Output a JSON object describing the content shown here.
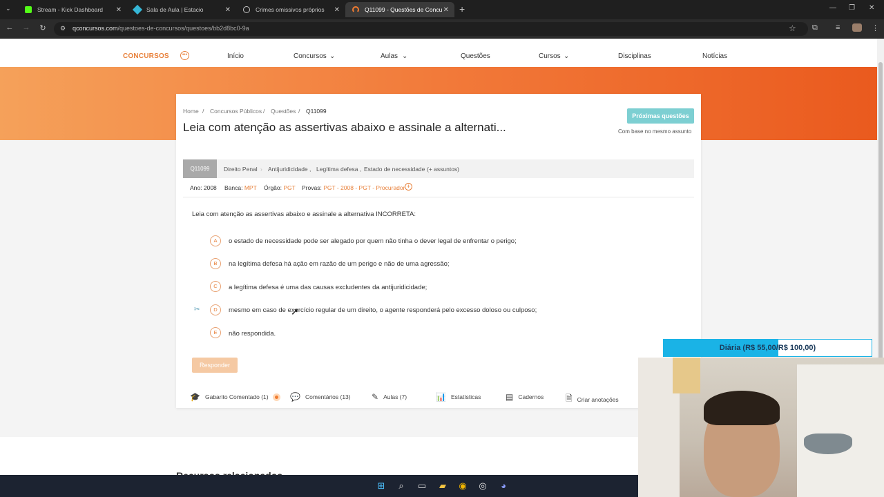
{
  "browser": {
    "tabs": [
      {
        "title": "Stream - Kick Dashboard",
        "active": false
      },
      {
        "title": "Sala de Aula | Estacio",
        "active": false
      },
      {
        "title": "Crimes omissivos próprios",
        "active": false
      },
      {
        "title": "Q11099 - Questões de Concurs",
        "active": true
      }
    ],
    "url_host": "qconcursos.com",
    "url_path": "/questoes-de-concursos/questoes/bb2d8bc0-9a"
  },
  "site": {
    "brand": "CONCURSOS",
    "nav": [
      "Início",
      "Concursos",
      "Aulas",
      "Questões",
      "Cursos",
      "Disciplinas",
      "Notícias"
    ],
    "breadcrumb": [
      "Home",
      "Concursos Públicos",
      "Questões",
      "Q11099"
    ],
    "title": "Leia com atenção as assertivas abaixo e assinale a alternati...",
    "next_button": "Próximas questões",
    "next_note": "Com base no mesmo assunto",
    "question": {
      "id": "Q11099",
      "subjects": [
        "Direito Penal",
        "Antijuridicidade ,",
        "Legítima defesa ,",
        "Estado de necessidade",
        "(+ assuntos)"
      ],
      "ano_label": "Ano:",
      "ano": "2008",
      "banca_label": "Banca:",
      "banca": "MPT",
      "orgao_label": "Órgão:",
      "orgao": "PGT",
      "provas_label": "Provas:",
      "provas": "PGT - 2008 - PGT - Procurador",
      "stem": "Leia com atenção as assertivas abaixo e assinale a alternativa INCORRETA:",
      "options": [
        {
          "letter": "A",
          "text": "o estado de necessidade pode ser alegado por quem não tinha o dever legal de enfrentar o perigo;"
        },
        {
          "letter": "B",
          "text": "na legítima defesa há ação em razão de um perigo e não de uma agressão;"
        },
        {
          "letter": "C",
          "text": "a legítima defesa é uma das causas excludentes da antijuridicidade;"
        },
        {
          "letter": "D",
          "text": "mesmo em caso de exercício regular de um direito, o agente responderá pelo excesso doloso ou culposo;"
        },
        {
          "letter": "E",
          "text": "não respondida."
        }
      ],
      "answer_button": "Responder"
    },
    "footer_tabs": [
      {
        "label": "Gabarito Comentado (1)",
        "icon": "graduation-cap-icon"
      },
      {
        "label": "Comentários (13)",
        "icon": "chat-icon"
      },
      {
        "label": "Aulas (7)",
        "icon": "edit-icon"
      },
      {
        "label": "Estatísticas",
        "icon": "bar-chart-icon"
      },
      {
        "label": "Cadernos",
        "icon": "notebook-icon"
      },
      {
        "label": "Criar anotações",
        "icon": "document-icon"
      }
    ],
    "related_heading": "Recursos relacionados"
  },
  "overlay": {
    "goal_text": "Diária (R$ 55,00/R$ 100,00)",
    "goal_progress": 0.55
  },
  "colors": {
    "accent": "#e8803a",
    "next_button": "#7dcfd2",
    "goal_bar": "#1ab3e6"
  }
}
